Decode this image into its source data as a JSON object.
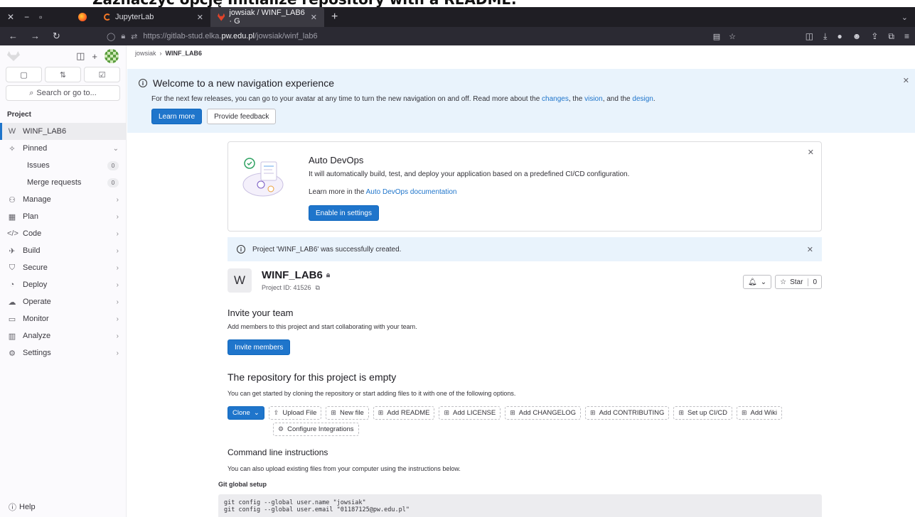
{
  "caption": "Zaznaczyć opcję Initialize repository with a README.",
  "browser": {
    "tabs": [
      {
        "label": "JupyterLab"
      },
      {
        "label": "jowsiak / WINF_LAB6 · G"
      }
    ],
    "url_prefix": "https://gitlab-stud.elka.",
    "url_host": "pw.edu.pl",
    "url_path": "/jowsiak/winf_lab6"
  },
  "sidebar": {
    "search": "Search or go to...",
    "section": "Project",
    "project_initial": "W",
    "project_name": "WINF_LAB6",
    "pinned": "Pinned",
    "issues": "Issues",
    "issues_count": "0",
    "merge_requests": "Merge requests",
    "mr_count": "0",
    "items": [
      "Manage",
      "Plan",
      "Code",
      "Build",
      "Secure",
      "Deploy",
      "Operate",
      "Monitor",
      "Analyze",
      "Settings"
    ],
    "help": "Help"
  },
  "breadcrumb": {
    "user": "jowsiak",
    "project": "WINF_LAB6"
  },
  "welcome": {
    "title": "Welcome to a new navigation experience",
    "text_before": "For the next few releases, you can go to your avatar at any time to turn the new navigation on and off. Read more about the",
    "link_changes": "changes",
    "sep1": ", the",
    "link_vision": "vision",
    "sep2": ", and the",
    "link_design": "design",
    "end": ".",
    "learn_more": "Learn more",
    "feedback": "Provide feedback"
  },
  "devops": {
    "title": "Auto DevOps",
    "desc": "It will automatically build, test, and deploy your application based on a predefined CI/CD configuration.",
    "learn_prefix": "Learn more in the",
    "learn_link": "Auto DevOps documentation",
    "button": "Enable in settings"
  },
  "success": "Project 'WINF_LAB6' was successfully created.",
  "project": {
    "initial": "W",
    "name": "WINF_LAB6",
    "id_label": "Project ID: 41526",
    "star": "Star",
    "star_count": "0"
  },
  "invite": {
    "title": "Invite your team",
    "text": "Add members to this project and start collaborating with your team.",
    "button": "Invite members"
  },
  "empty": {
    "title": "The repository for this project is empty",
    "text": "You can get started by cloning the repository or start adding files to it with one of the following options.",
    "clone": "Clone",
    "buttons": [
      "Upload File",
      "New file",
      "Add README",
      "Add LICENSE",
      "Add CHANGELOG",
      "Add CONTRIBUTING",
      "Set up CI/CD",
      "Add Wiki"
    ],
    "configure": "Configure Integrations"
  },
  "cli": {
    "title": "Command line instructions",
    "text": "You can also upload existing files from your computer using the instructions below.",
    "global_setup": "Git global setup",
    "lines": [
      "git config --global user.name \"jowsiak\"",
      "git config --global user.email \"01187125@pw.edu.pl\""
    ]
  }
}
